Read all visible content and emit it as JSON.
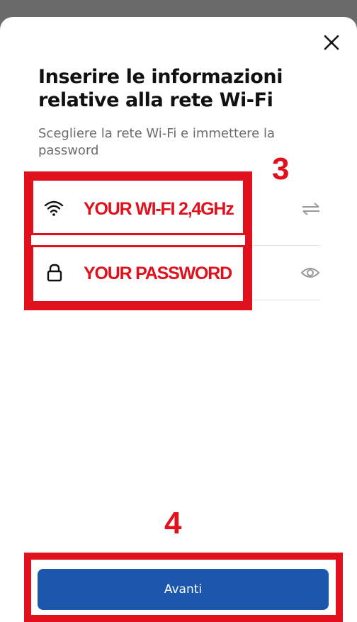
{
  "dialog": {
    "title": "Inserire le informazioni relative alla rete Wi-Fi",
    "subtitle": "Scegliere la rete Wi-Fi e immettere la password",
    "close_icon": "close-icon"
  },
  "wifi_field": {
    "value": "YOUR WI-FI 2,4GHz",
    "leading_icon": "wifi-icon",
    "trailing_icon": "swap-arrows-icon"
  },
  "password_field": {
    "value": "YOUR PASSWORD",
    "leading_icon": "lock-icon",
    "trailing_icon": "eye-icon"
  },
  "annotations": {
    "step_fields": "3",
    "step_button": "4",
    "color": "#e0101c"
  },
  "footer": {
    "next_label": "Avanti",
    "button_color": "#1c57ad"
  }
}
